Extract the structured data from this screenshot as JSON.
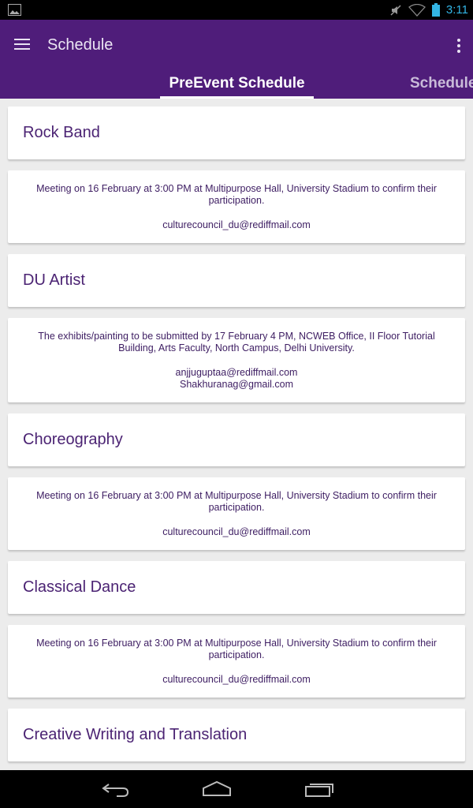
{
  "status": {
    "time": "3:11"
  },
  "app": {
    "title": "Schedule"
  },
  "tabs": {
    "active": "PreEvent Schedule",
    "next": "Schedule"
  },
  "events": [
    {
      "title": "Rock Band",
      "description": "Meeting on 16 February at 3:00 PM at Multipurpose Hall, University Stadium  to confirm their participation.",
      "email1": "culturecouncil_du@rediffmail.com",
      "email2": ""
    },
    {
      "title": "DU Artist",
      "description": "The exhibits/painting to be submitted by 17 February 4 PM, NCWEB Office, II Floor Tutorial Building, Arts Faculty, North Campus, Delhi University.",
      "email1": "anjjuguptaa@rediffmail.com",
      "email2": "Shakhuranag@gmail.com"
    },
    {
      "title": "Choreography",
      "description": "Meeting on 16 February at 3:00 PM at Multipurpose Hall, University Stadium  to confirm their participation.",
      "email1": "culturecouncil_du@rediffmail.com",
      "email2": ""
    },
    {
      "title": "Classical Dance",
      "description": "Meeting on 16 February at 3:00 PM at Multipurpose Hall, University Stadium  to confirm their participation.",
      "email1": "culturecouncil_du@rediffmail.com",
      "email2": ""
    },
    {
      "title": "Creative Writing and Translation",
      "description": "",
      "email1": "",
      "email2": ""
    }
  ],
  "colors": {
    "primary": "#4f1d7a",
    "text": "#4b2373",
    "status_time": "#33b5e5"
  }
}
